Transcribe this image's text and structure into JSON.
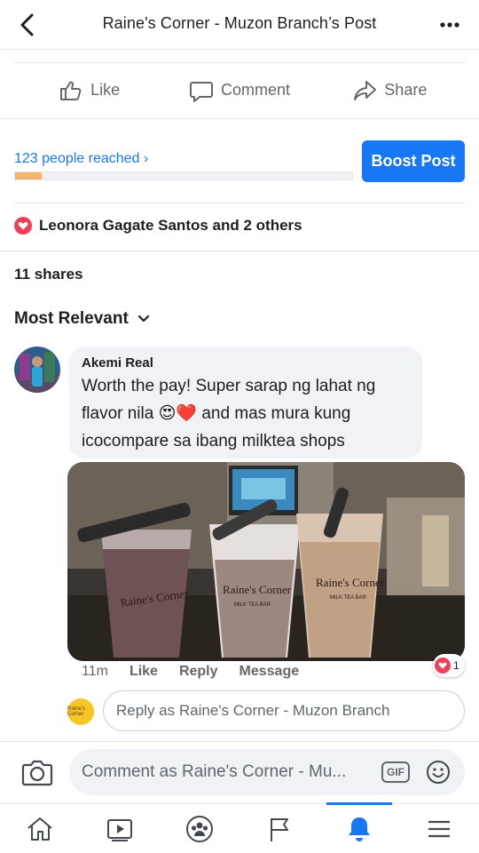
{
  "header": {
    "title": "Raine's Corner - Muzon Branch’s Post",
    "back_icon": "chevron-left-icon",
    "more_icon": "more-horizontal-icon"
  },
  "post_actions": [
    {
      "label": "Like",
      "icon": "thumbs-up-icon"
    },
    {
      "label": "Comment",
      "icon": "comment-icon"
    },
    {
      "label": "Share",
      "icon": "share-arrow-icon"
    }
  ],
  "reach": {
    "text": "123 people reached ›",
    "progress_percent": 8,
    "boost_label": "Boost Post"
  },
  "reactions": {
    "summary": "Leonora Gagate Santos and 2 others",
    "icon": "love-reaction-icon",
    "color": "#f33e58"
  },
  "shares": "11 shares",
  "sort": {
    "label": "Most Relevant",
    "icon": "chevron-down-icon"
  },
  "comment": {
    "author": "Akemi Real",
    "text_part1": "Worth the pay! Super sarap ng lahat ng flavor nila",
    "text_emojis": "😍❤️",
    "text_part2": " and mas mura kung icocompare sa ibang milktea shops",
    "time": "11m",
    "like_label": "Like",
    "reply_label": "Reply",
    "message_label": "Message",
    "reaction_count": "1",
    "cup_logo_text": "Raine's Corner",
    "cup_sub_text": "MILK TEA BAR"
  },
  "reply_box": {
    "placeholder": "Reply as Raine's Corner - Muzon Branch",
    "avatar_text": "Raine's Corner"
  },
  "composer": {
    "placeholder": "Comment as Raine's Corner - Mu...",
    "gif_label": "GIF",
    "camera_icon": "camera-icon",
    "emoji_icon": "smiley-icon"
  },
  "tabs": [
    {
      "name": "home-icon",
      "active": false
    },
    {
      "name": "video-icon",
      "active": false
    },
    {
      "name": "groups-icon",
      "active": false
    },
    {
      "name": "pages-flag-icon",
      "active": false
    },
    {
      "name": "notifications-bell-icon",
      "active": true
    },
    {
      "name": "menu-icon",
      "active": false
    }
  ],
  "colors": {
    "accent": "#1877f2",
    "reach_bar": "#f7b36a",
    "bubble": "#f0f2f5"
  }
}
